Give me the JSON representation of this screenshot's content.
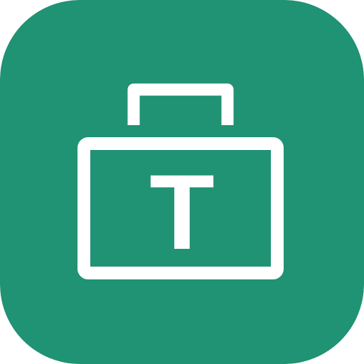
{
  "icon": {
    "name": "briefcase-t-icon",
    "glyph": "T",
    "background_color": "#1f9374",
    "foreground_color": "#ffffff"
  }
}
